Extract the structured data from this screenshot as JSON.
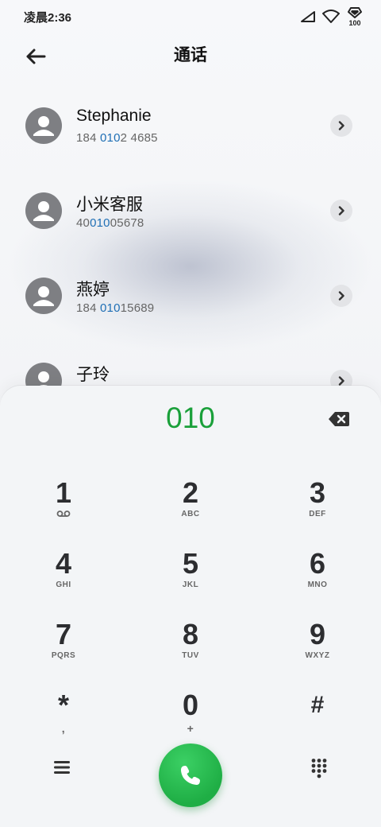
{
  "status_bar": {
    "time": "凌晨2:36",
    "battery_level": "100",
    "icons": [
      "cellular-signal-icon",
      "wifi-icon",
      "battery-icon"
    ]
  },
  "header": {
    "title": "通话",
    "back_icon": "arrow-left-icon"
  },
  "contacts": [
    {
      "name": "Stephanie",
      "number_pre": "184 ",
      "number_match": "010",
      "number_post": "2 4685"
    },
    {
      "name": "小米客服",
      "number_pre": "40",
      "number_match": "010",
      "number_post": "05678"
    },
    {
      "name": "燕婷",
      "number_pre": "184 ",
      "number_match": "010",
      "number_post": "15689"
    },
    {
      "name": "子玲",
      "number_pre": "",
      "number_match": "",
      "number_post": ""
    }
  ],
  "dialer": {
    "input": "010",
    "keys": [
      {
        "digit": "1",
        "letters": ""
      },
      {
        "digit": "2",
        "letters": "ABC"
      },
      {
        "digit": "3",
        "letters": "DEF"
      },
      {
        "digit": "4",
        "letters": "GHI"
      },
      {
        "digit": "5",
        "letters": "JKL"
      },
      {
        "digit": "6",
        "letters": "MNO"
      },
      {
        "digit": "7",
        "letters": "PQRS"
      },
      {
        "digit": "8",
        "letters": "TUV"
      },
      {
        "digit": "9",
        "letters": "WXYZ"
      },
      {
        "digit": "*",
        "letters": ","
      },
      {
        "digit": "0",
        "letters": "+"
      },
      {
        "digit": "#",
        "letters": ""
      }
    ]
  },
  "colors": {
    "accent_green": "#1aa03a",
    "match_blue": "#1f6fb5",
    "call_button": "#1fae45"
  }
}
